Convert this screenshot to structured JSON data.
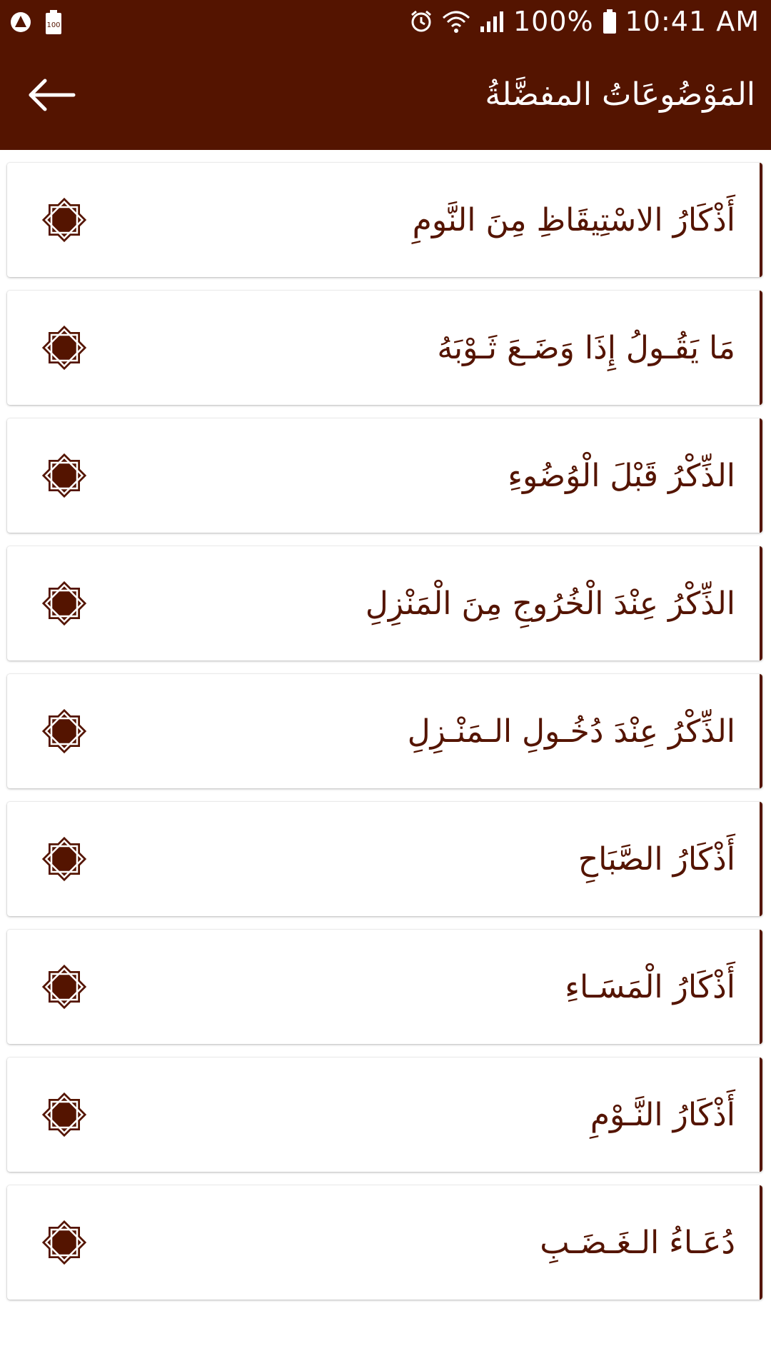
{
  "status_bar": {
    "battery_percent": "100%",
    "time": "10:41 AM",
    "left_icons": [
      "app-notification-icon",
      "battery-100-icon"
    ],
    "right_icons": [
      "alarm-icon",
      "wifi-icon",
      "signal-icon",
      "battery-icon"
    ]
  },
  "app_bar": {
    "title": "المَوْضُوعَاتُ المفضَّلةُ",
    "back_icon": "arrow-left-icon"
  },
  "colors": {
    "primary": "#541400",
    "background": "#ffffff",
    "text_on_primary": "#ffffff"
  },
  "items": [
    {
      "label": "أَذْكَارُ الاسْتِيقَاظِ مِنَ النَّومِ",
      "icon": "eight-point-star-icon"
    },
    {
      "label": "مَا يَقُـولُ إِذَا وَضَـعَ ثَـوْبَهُ",
      "icon": "eight-point-star-icon"
    },
    {
      "label": "الذِّكْرُ قَبْلَ الْوُضُوءِ",
      "icon": "eight-point-star-icon"
    },
    {
      "label": "الذِّكْرُ عِنْدَ الْخُرُوجِ مِنَ الْمَنْزِلِ",
      "icon": "eight-point-star-icon"
    },
    {
      "label": "الذِّكْرُ عِنْدَ دُخُـولِ الـمَنْـزِلِ",
      "icon": "eight-point-star-icon"
    },
    {
      "label": "أَذْكَارُ الصَّبَاحِ",
      "icon": "eight-point-star-icon"
    },
    {
      "label": "أَذْكَارُ الْمَسَـاءِ",
      "icon": "eight-point-star-icon"
    },
    {
      "label": "أَذْكَارُ النَّـوْمِ",
      "icon": "eight-point-star-icon"
    },
    {
      "label": "دُعَـاءُ الـغَـضَـبِ",
      "icon": "eight-point-star-icon"
    }
  ]
}
